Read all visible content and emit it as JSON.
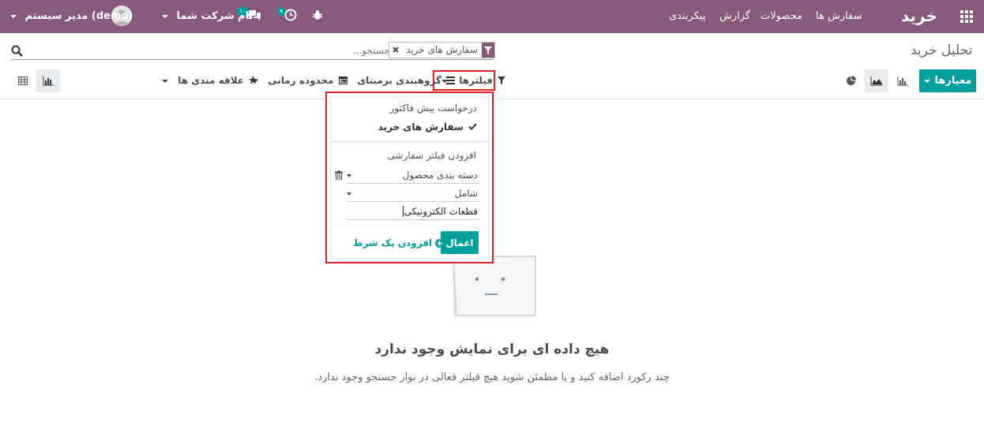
{
  "navbar": {
    "brand": "خرید",
    "menu": [
      "سفارش ها",
      "محصولات",
      "گزارش",
      "پیکربندی"
    ],
    "user_name": "مدیر سیستم (demo)",
    "company": "نام شرکت شما",
    "chat_badge": "۱۰",
    "activity_badge": "۹"
  },
  "control_panel": {
    "title": "تحلیل خرید",
    "search": {
      "placeholder": "جستجو...",
      "facet_value": "سفارش های خرید"
    },
    "measures_label": "معیارها",
    "filters_label": "فیلترها",
    "groupby_label": "گروهبندی برمبنای",
    "timerange_label": "محدوده زمانی",
    "favorites_label": "علاقه مندی ها"
  },
  "filter_dropdown": {
    "items": [
      {
        "label": "درخواست پیش فاکتور",
        "checked": false
      },
      {
        "label": "سفارش های خرید",
        "checked": true
      }
    ],
    "custom_filter_label": "افزودن فیلتر سفارشی",
    "field_select": "دسته بندی محصول",
    "operator_select": "شامل",
    "value_input": "قطعات الکترونیکی",
    "apply_label": "اعمال",
    "add_condition_label": "افزودن یک شرط"
  },
  "empty_state": {
    "title": "هیچ داده ای برای نمایش وجود ندارد",
    "subtitle": "چند رکورد اضافه کنید و یا مطمئن شوید هیچ فیلتر فعالی در نوار جستجو وجود ندارد."
  },
  "colors": {
    "navbar": "#875a7b",
    "primary": "#00a09d",
    "highlight": "#e31e24"
  }
}
